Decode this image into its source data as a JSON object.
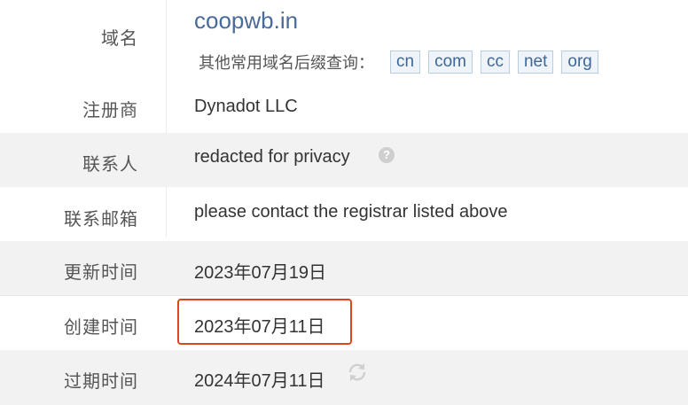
{
  "rows": {
    "domain": {
      "label": "域名",
      "value": "coopwb.in",
      "suffix_title": "其他常用域名后缀查询：",
      "suffixes": [
        "cn",
        "com",
        "cc",
        "net",
        "org"
      ]
    },
    "registrar": {
      "label": "注册商",
      "value": "Dynadot LLC"
    },
    "contact": {
      "label": "联系人",
      "value": "redacted for privacy",
      "help_icon": "question-circle-icon"
    },
    "email": {
      "label": "联系邮箱",
      "value": "please contact the registrar listed above"
    },
    "updated": {
      "label": "更新时间",
      "value": "2023年07月19日"
    },
    "created": {
      "label": "创建时间",
      "value": "2023年07月11日"
    },
    "expires": {
      "label": "过期时间",
      "value": "2024年07月11日",
      "refresh_icon": "refresh-icon"
    }
  },
  "colors": {
    "shaded_row": "#f2f2f2",
    "highlight_border": "#d9461c",
    "link": "#4a6a98"
  }
}
